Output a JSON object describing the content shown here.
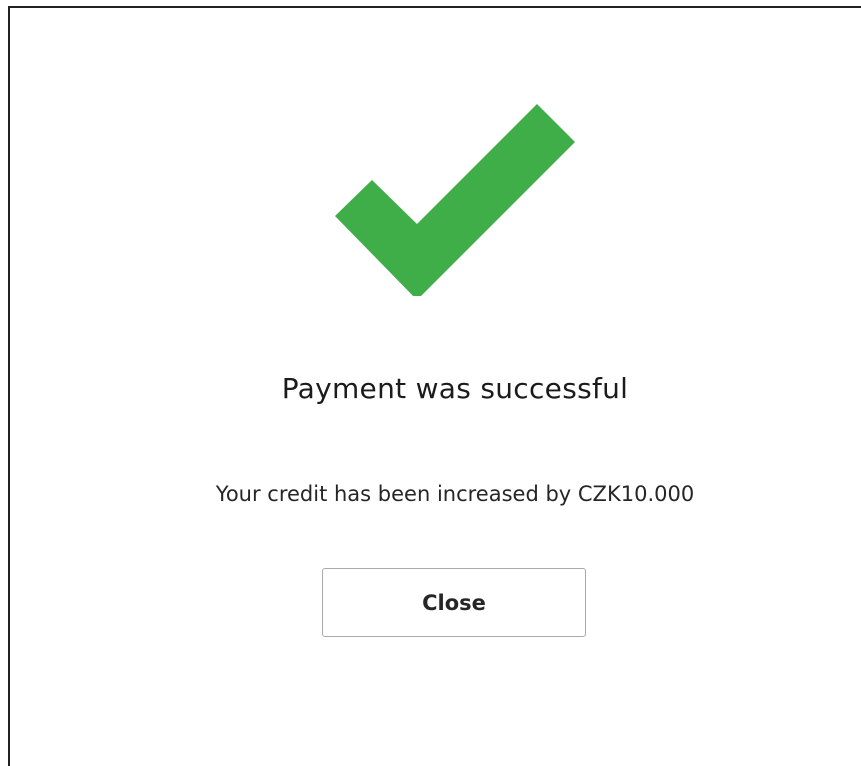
{
  "dialog": {
    "icon": "checkmark-icon",
    "title": "Payment was successful",
    "message": "Your credit has been increased by CZK10.000",
    "close_label": "Close",
    "colors": {
      "success": "#3fae49",
      "text": "#1b1b1b",
      "border": "#222222",
      "button_border": "#a9a9a9"
    }
  }
}
